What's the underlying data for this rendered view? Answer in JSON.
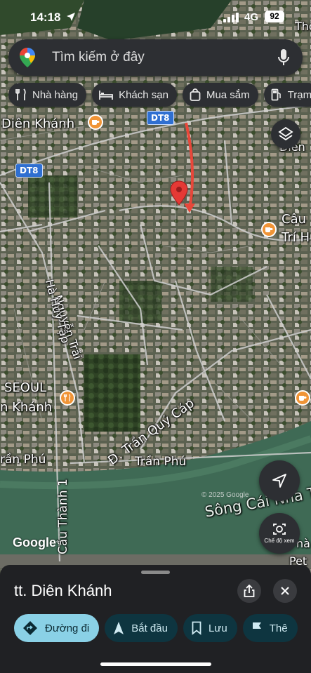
{
  "status_bar": {
    "time": "14:18",
    "network": "4G",
    "battery": "92"
  },
  "search": {
    "placeholder": "Tìm kiếm ở đây"
  },
  "chips": [
    {
      "label": "Nhà hàng",
      "icon": "fork-knife-icon"
    },
    {
      "label": "Khách sạn",
      "icon": "bed-icon"
    },
    {
      "label": "Mua sắm",
      "icon": "shopping-bag-icon"
    },
    {
      "label": "Trạm",
      "icon": "gas-station-icon"
    }
  ],
  "map": {
    "roads": {
      "dt8_a": "DT8",
      "dt8_b": "DT8"
    },
    "labels": {
      "dien_khanh": "Diên Khánh",
      "dien_right": "Diên",
      "thon": "Thôn",
      "cau_tri": "Câu",
      "tri_h": "Trí H",
      "nguyen_trai": "Nguyễn Trãi",
      "ha_huy_tap": "Hà Huy Tập",
      "seoul": "SEOUL",
      "khanh": "n Khánh",
      "tran_quy_cap": "Đ. Trần Quý Cáp",
      "tran_phu_left": "rần Phú",
      "tran_phu": "Trần Phú",
      "cau_thanh": "Cầu Thành 1",
      "song_cai": "Sông Cái Nha T",
      "pet": "Pet",
      "na": "nà"
    },
    "copyright": "© 2025 Google",
    "logo": "Google",
    "street_view_label": "Chế độ xem",
    "route_color": "#e8473a",
    "pin_color": "#e53935"
  },
  "sheet": {
    "place_name": "tt. Diên Khánh",
    "actions": [
      {
        "label": "Đường đi",
        "icon": "directions-icon",
        "style": "primary"
      },
      {
        "label": "Bắt đầu",
        "icon": "navigation-arrow-icon",
        "style": "secondary"
      },
      {
        "label": "Lưu",
        "icon": "bookmark-icon",
        "style": "secondary"
      },
      {
        "label": "Thê",
        "icon": "flag-icon",
        "style": "secondary"
      }
    ]
  },
  "colors": {
    "sheet_bg": "#202124",
    "primary_action": "#8ad1e6",
    "secondary_action": "#0e3540",
    "poi": "#f09436"
  }
}
